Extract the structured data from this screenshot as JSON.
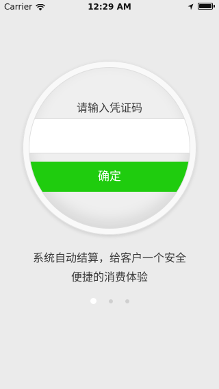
{
  "status_bar": {
    "carrier": "Carrier",
    "time": "12:29 AM",
    "icons": [
      "wifi-icon",
      "location-icon",
      "battery-icon"
    ]
  },
  "card": {
    "title": "请输入凭证码",
    "input_value": "",
    "input_placeholder": "",
    "confirm_label": "确定",
    "accent_color": "#1fcc0e"
  },
  "description": {
    "line1": "系统自动结算，给客户一个安全",
    "line2": "便捷的消费体验"
  },
  "pagination": {
    "total": 3,
    "current": 1
  }
}
